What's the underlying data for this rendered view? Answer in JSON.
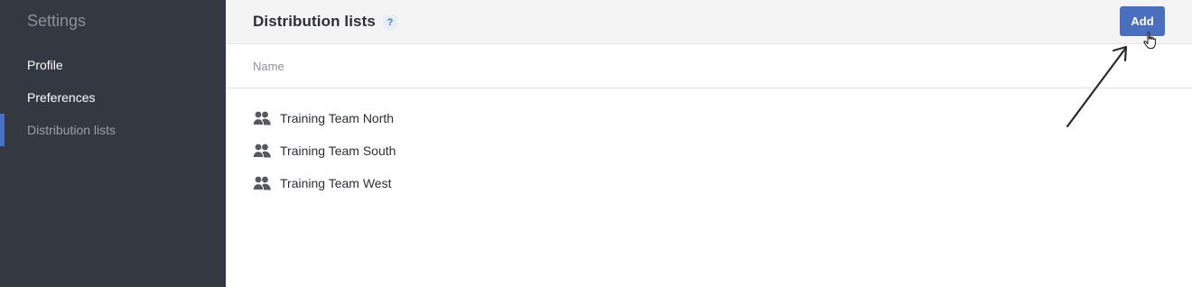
{
  "sidebar": {
    "title": "Settings",
    "items": [
      {
        "label": "Profile",
        "active": false
      },
      {
        "label": "Preferences",
        "active": false
      },
      {
        "label": "Distribution lists",
        "active": true
      }
    ]
  },
  "header": {
    "title": "Distribution lists",
    "help_label": "?",
    "add_label": "Add"
  },
  "table": {
    "column_name": "Name",
    "rows": [
      {
        "name": "Training Team North",
        "icon": "group-icon"
      },
      {
        "name": "Training Team South",
        "icon": "group-icon"
      },
      {
        "name": "Training Team West",
        "icon": "group-icon"
      }
    ]
  },
  "colors": {
    "sidebar_bg": "#343840",
    "accent": "#4a6fbf",
    "active_indicator": "#4a72c4"
  }
}
